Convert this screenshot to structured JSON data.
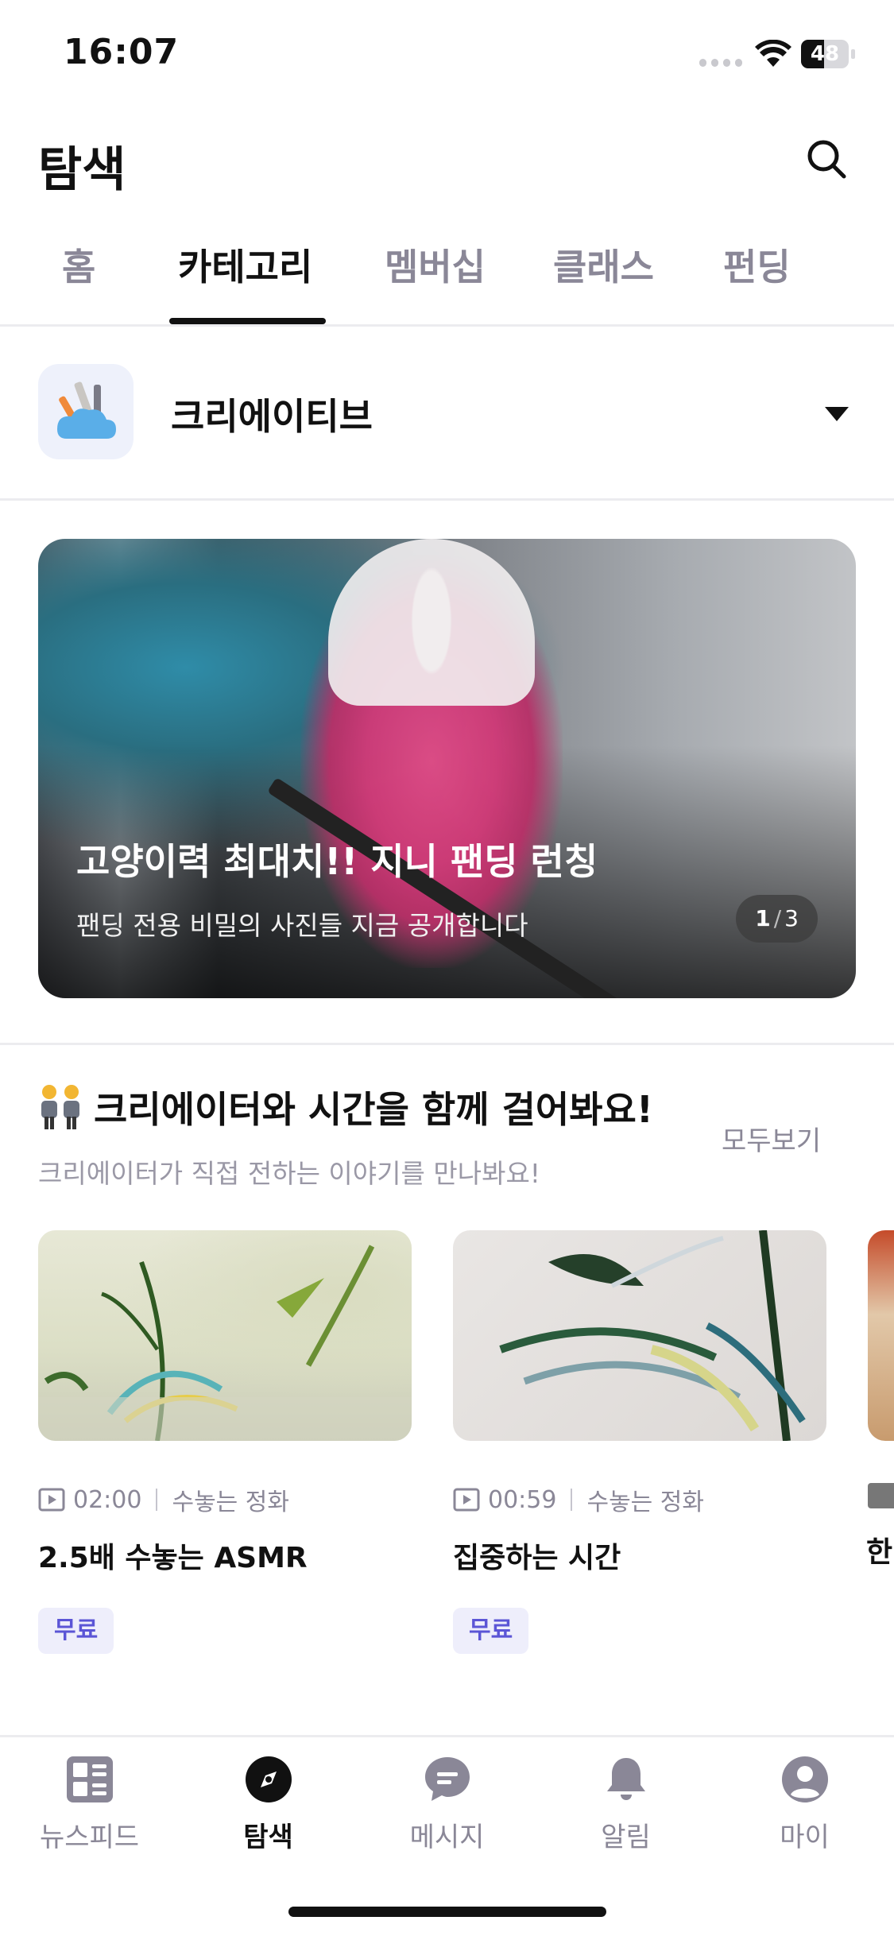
{
  "status_bar": {
    "time": "16:07",
    "battery": "48",
    "battery_level_percent": 48
  },
  "header": {
    "title": "탐색",
    "search_icon": "search-icon"
  },
  "tabs": [
    {
      "label": "홈",
      "active": false
    },
    {
      "label": "카테고리",
      "active": true
    },
    {
      "label": "멤버십",
      "active": false
    },
    {
      "label": "클래스",
      "active": false
    },
    {
      "label": "펀딩",
      "active": false
    }
  ],
  "category": {
    "label": "크리에이티브",
    "icon": "creative-tools-icon",
    "caret_icon": "caret-down-icon"
  },
  "banner": {
    "title": "고양이력 최대치!! 지니 팬딩 런칭",
    "subtitle": "팬딩 전용 비밀의 사진들 지금 공개합니다",
    "current": "1",
    "separator": "/",
    "total": "3"
  },
  "section": {
    "title": "크리에이터와 시간을 함께 걸어봐요!",
    "subtitle": "크리에이터가 직접 전하는 이야기를 만나봐요!",
    "see_all": "모두보기",
    "icon": "people-icon"
  },
  "cards": [
    {
      "duration": "02:00",
      "creator": "수놓는 정화",
      "title": "2.5배 수놓는 ASMR",
      "badge": "무료"
    },
    {
      "duration": "00:59",
      "creator": "수놓는 정화",
      "title": "집중하는 시간",
      "badge": "무료"
    },
    {
      "title_partial": "한"
    }
  ],
  "bottom_nav": [
    {
      "label": "뉴스피드",
      "icon": "newsfeed-icon",
      "active": false
    },
    {
      "label": "탐색",
      "icon": "compass-icon",
      "active": true
    },
    {
      "label": "메시지",
      "icon": "chat-icon",
      "active": false
    },
    {
      "label": "알림",
      "icon": "bell-icon",
      "active": false
    },
    {
      "label": "마이",
      "icon": "profile-icon",
      "active": false
    }
  ],
  "colors": {
    "accent": "#5b55d6",
    "badge_bg": "#eeeefb",
    "muted": "#8a8797",
    "text": "#111111"
  }
}
